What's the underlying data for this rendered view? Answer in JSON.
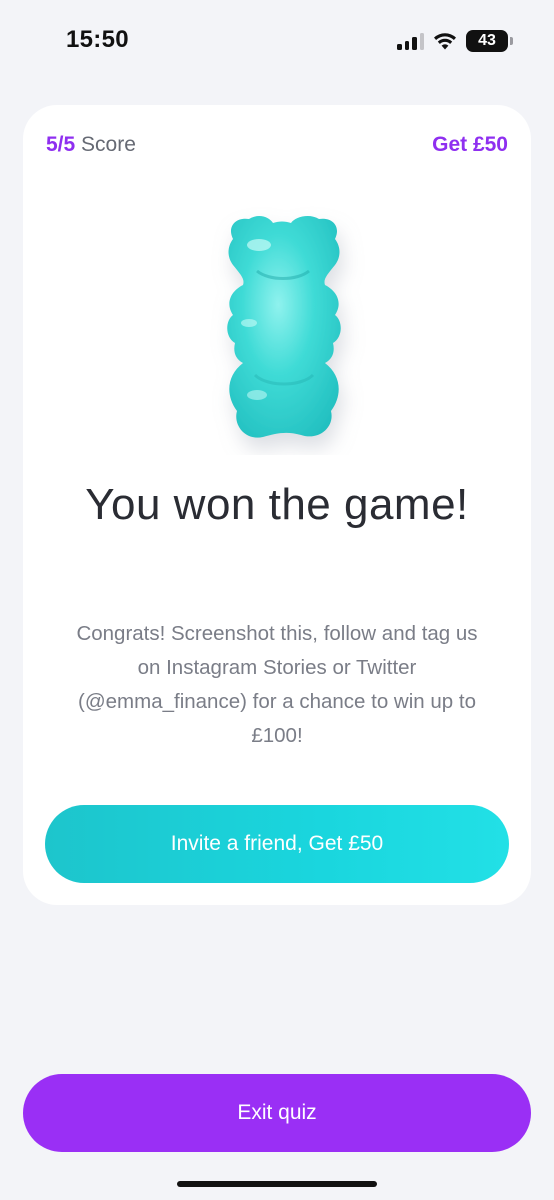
{
  "status_bar": {
    "time": "15:50",
    "battery": "43",
    "signal_icon": "cellular-signal-icon",
    "wifi_icon": "wifi-icon",
    "battery_icon": "battery-icon"
  },
  "card": {
    "score_value": "5/5",
    "score_label": "Score",
    "reward_link": "Get £50",
    "image": "gummy-bear-icon",
    "title": "You won the game!",
    "message": "Congrats! Screenshot this, follow and tag us on Instagram Stories or Twitter (@emma_finance) for a chance to win up to £100!",
    "invite_button": "Invite a friend, Get £50"
  },
  "exit_button": "Exit quiz",
  "colors": {
    "accent_purple": "#9a2ff5",
    "accent_teal": "#1dd0d8",
    "background": "#f3f4f8"
  }
}
